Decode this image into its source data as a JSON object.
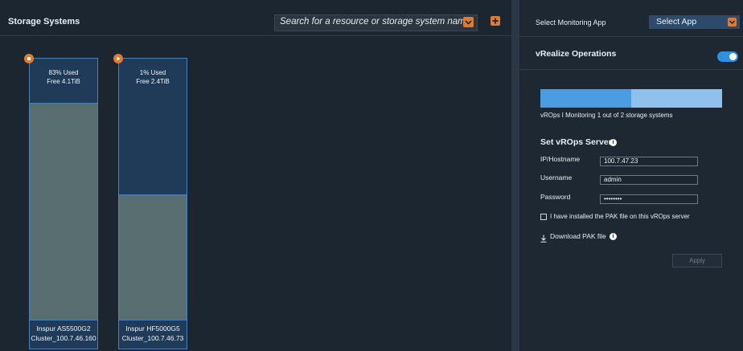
{
  "storage_panel": {
    "title": "Storage Systems",
    "search_placeholder": "Search for a resource or storage system name"
  },
  "storage_systems": [
    {
      "used": "83% Used",
      "free": "Free 4.1TiB",
      "name": "Inspur AS5500G2",
      "cluster": "Cluster_100.7.46.160",
      "fill_fraction": 0.83
    },
    {
      "used": "1% Used",
      "free": "Free 2.4TiB",
      "name": "Inspur HF5000G5",
      "cluster": "Cluster_100.7.46.73",
      "fill_fraction": 0.48
    }
  ],
  "monitoring": {
    "label": "Select Monitoring App",
    "select_value": "Select App",
    "app_title": "vRealize Operations",
    "toggle_on": true,
    "progress_fraction": 0.5,
    "progress_caption": "vROps I Monitoring 1 out of 2 storage systems",
    "server_title": "Set vROps Server",
    "ip_label": "IP/Hostname",
    "ip_value": "100.7.47.23",
    "username_label": "Username",
    "username_value": "admin",
    "password_label": "Password",
    "password_value": "••••••••",
    "pak_checkbox_label": "I have installed the PAK file on this vROps server",
    "download_label": "Download PAK file",
    "apply_label": "Apply"
  },
  "colors": {
    "accent_orange": "#e07a2e",
    "toggle_blue": "#2f8fe0",
    "progress_blue": "#4b9ce3",
    "card_blue": "#203b58",
    "card_fill": "#586e71"
  }
}
